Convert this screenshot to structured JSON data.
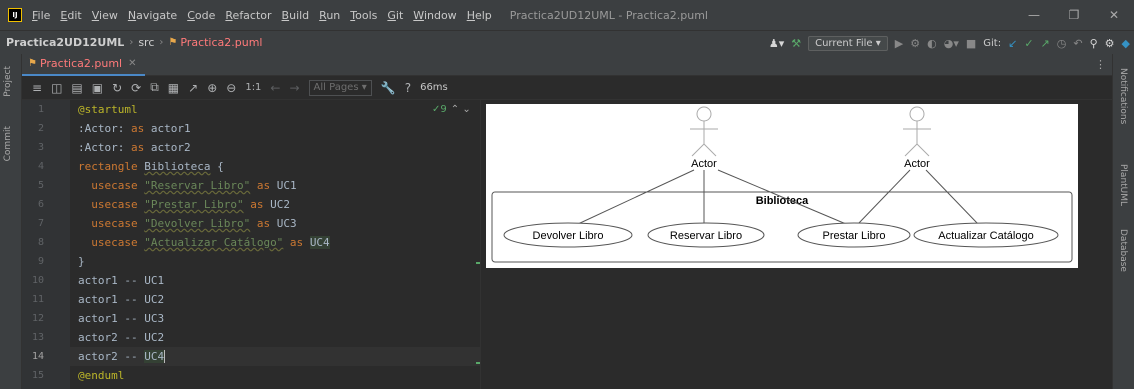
{
  "titlebar": {
    "logo_text": "IJ",
    "menu": [
      "File",
      "Edit",
      "View",
      "Navigate",
      "Code",
      "Refactor",
      "Build",
      "Run",
      "Tools",
      "Git",
      "Window",
      "Help"
    ],
    "window_title": "Practica2UD12UML - Practica2.puml"
  },
  "navbar": {
    "project": "Practica2UD12UML",
    "folder": "src",
    "file": "Practica2.puml",
    "run_config": "Current File",
    "git_label": "Git:"
  },
  "left_strip": {
    "project_label": "Project",
    "commit_label": "Commit"
  },
  "right_strip": {
    "notifications_label": "Notifications",
    "plantuml_label": "PlantUML",
    "database_label": "Database"
  },
  "tab": {
    "label": "Practica2.puml"
  },
  "toolbar": {
    "pages": "All Pages",
    "zoom": "1:1",
    "timing": "66ms"
  },
  "inspection": {
    "count": "9"
  },
  "code": {
    "line_numbers": [
      "1",
      "2",
      "3",
      "4",
      "5",
      "6",
      "7",
      "8",
      "9",
      "10",
      "11",
      "12",
      "13",
      "14",
      "15"
    ],
    "l1": "@startuml",
    "l2a": ":Actor:",
    "l2b": " as ",
    "l2c": "actor1",
    "l3a": ":Actor:",
    "l3b": " as ",
    "l3c": "actor2",
    "l4a": "rectangle",
    "l4b": " ",
    "l4c": "Biblioteca",
    "l4d": " {",
    "l5a": "  usecase ",
    "l5b": "\"Reservar Libro\"",
    "l5c": " as ",
    "l5d": "UC1",
    "l6a": "  usecase ",
    "l6b": "\"Prestar Libro\"",
    "l6c": " as ",
    "l6d": "UC2",
    "l7a": "  usecase ",
    "l7b": "\"Devolver Libro\"",
    "l7c": " as ",
    "l7d": "UC3",
    "l8a": "  usecase ",
    "l8b": "\"Actualizar Catálogo\"",
    "l8c": " as ",
    "l8d": "UC4",
    "l9": "}",
    "l10": "actor1 -- UC1",
    "l11": "actor1 -- UC2",
    "l12": "actor1 -- UC3",
    "l13": "actor2 -- UC2",
    "l14a": "actor2 -- ",
    "l14b": "UC4",
    "l15": "@enduml"
  },
  "diagram": {
    "actor1_label": "Actor",
    "actor2_label": "Actor",
    "rectangle_label": "Biblioteca",
    "uc_devolver": "Devolver Libro",
    "uc_reservar": "Reservar Libro",
    "uc_prestar": "Prestar Libro",
    "uc_actualizar": "Actualizar Catálogo"
  }
}
